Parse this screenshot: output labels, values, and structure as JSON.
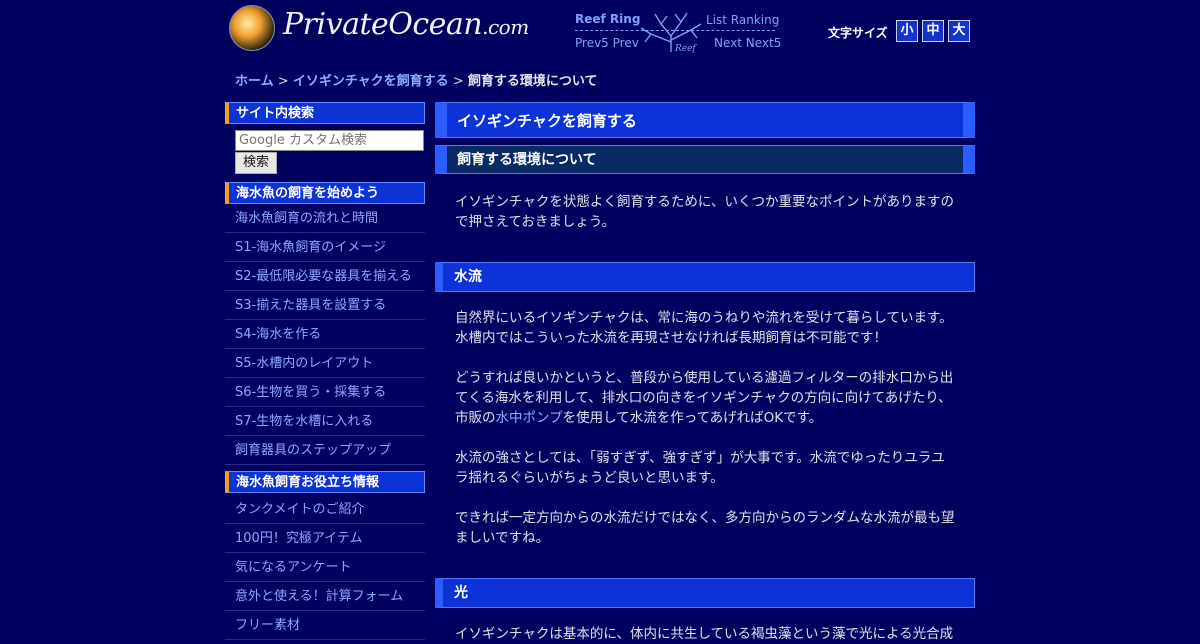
{
  "header": {
    "logo_text": "PrivateOcean",
    "logo_suffix": ".com"
  },
  "reef_ring": {
    "title": "Reef Ring",
    "list": "List Ranking",
    "prev": "Prev5 Prev",
    "next": "Next Next5",
    "coral_label": "Reef"
  },
  "font_size": {
    "label": "文字サイズ",
    "small": "小",
    "medium": "中",
    "large": "大"
  },
  "breadcrumb": {
    "home": "ホーム",
    "sep": ">",
    "parent": "イソギンチャクを飼育する",
    "current": "飼育する環境について"
  },
  "sidebar": {
    "search_title": "サイト内検索",
    "search_placeholder": "Google カスタム検索",
    "search_button": "検索",
    "section1_title": "海水魚の飼育を始めよう",
    "section1_items": [
      "海水魚飼育の流れと時間",
      "S1-海水魚飼育のイメージ",
      "S2-最低限必要な器具を揃える",
      "S3-揃えた器具を設置する",
      "S4-海水を作る",
      "S5-水槽内のレイアウト",
      "S6-生物を買う・採集する",
      "S7-生物を水槽に入れる",
      "飼育器具のステップアップ"
    ],
    "section2_title": "海水魚飼育お役立ち情報",
    "section2_items": [
      "タンクメイトのご紹介",
      "100円！究極アイテム",
      "気になるアンケート",
      "意外と使える！計算フォーム",
      "フリー素材"
    ]
  },
  "main": {
    "title": "イソギンチャクを飼育する",
    "subtitle": "飼育する環境について",
    "intro": "イソギンチャクを状態よく飼育するために、いくつか重要なポイントがありますので押さえておきましょう。",
    "section_water": "水流",
    "water_p1": "自然界にいるイソギンチャクは、常に海のうねりや流れを受けて暮らしています。水槽内ではこういった水流を再現させなければ長期飼育は不可能です！",
    "water_p2_before": "どうすれば良いかというと、普段から使用している濾過フィルターの排水口から出てくる海水を利用して、排水口の向きをイソギンチャクの方向に向けてあげたり、市販の",
    "water_p2_link": "水中ポンプ",
    "water_p2_after": "を使用して水流を作ってあげればOKです。",
    "water_p3": "水流の強さとしては、「弱すぎず、強すぎず」が大事です。水流でゆったりユラユラ揺れるぐらいがちょうど良いと思います。",
    "water_p4": "できれば一定方向からの水流だけではなく、多方向からのランダムな水流が最も望ましいですね。",
    "section_light": "光",
    "light_p1": "イソギンチャクは基本的に、体内に共生している褐虫藻という藻で光による光合成"
  }
}
